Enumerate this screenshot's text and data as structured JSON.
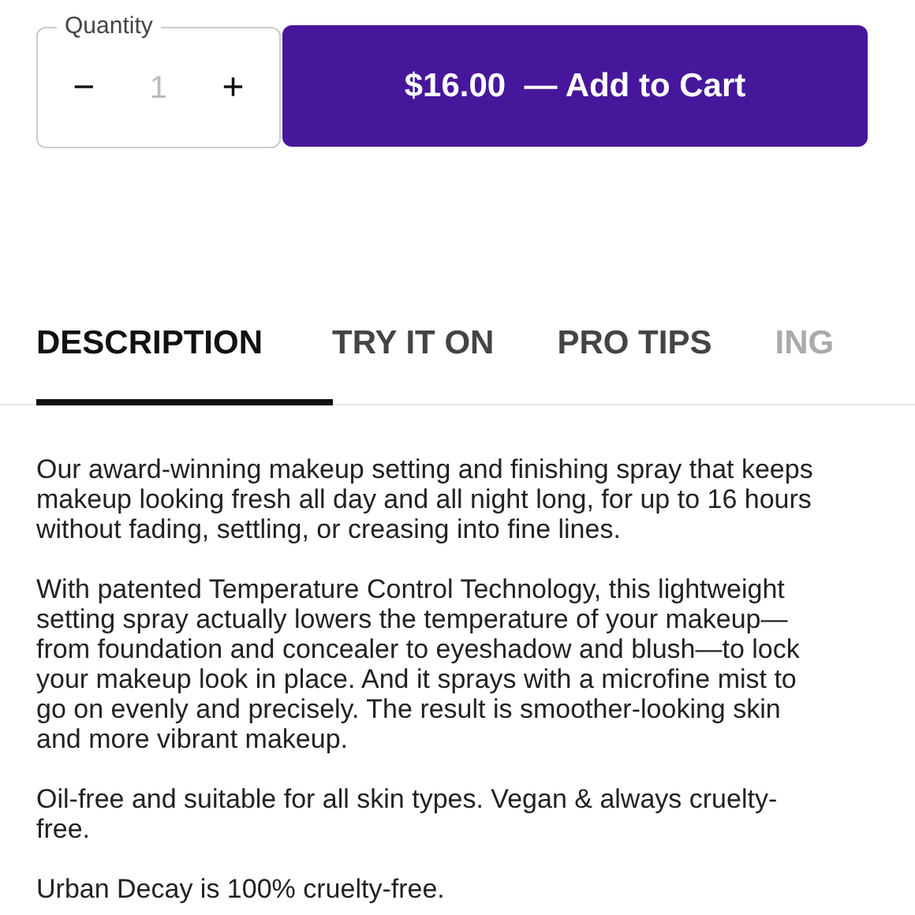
{
  "quantity": {
    "label": "Quantity",
    "decrement": "−",
    "value": "1",
    "increment": "+"
  },
  "add_to_cart": {
    "price": "$16.00",
    "label": "— Add to Cart"
  },
  "tabs": [
    {
      "label": "DESCRIPTION",
      "selected": true
    },
    {
      "label": "TRY IT ON",
      "selected": false
    },
    {
      "label": "PRO TIPS",
      "selected": false
    },
    {
      "label": "ING",
      "selected": false
    }
  ],
  "paragraphs": [
    "Our award-winning makeup setting and finishing spray that keeps makeup looking fresh all day and all night long, for up to 16 hours without fading, settling, or creasing into fine lines.",
    "With patented Temperature Control Technology, this lightweight setting spray actually lowers the temperature of your makeup—from foundation and concealer to eyeshadow and blush—to lock your makeup look in place. And it sprays with a microfine mist to go on evenly and precisely. The result is smoother-looking skin and more vibrant makeup.",
    "Oil-free and suitable for all skin types. Vegan & always cruelty-free.",
    "Urban Decay is 100% cruelty-free."
  ]
}
